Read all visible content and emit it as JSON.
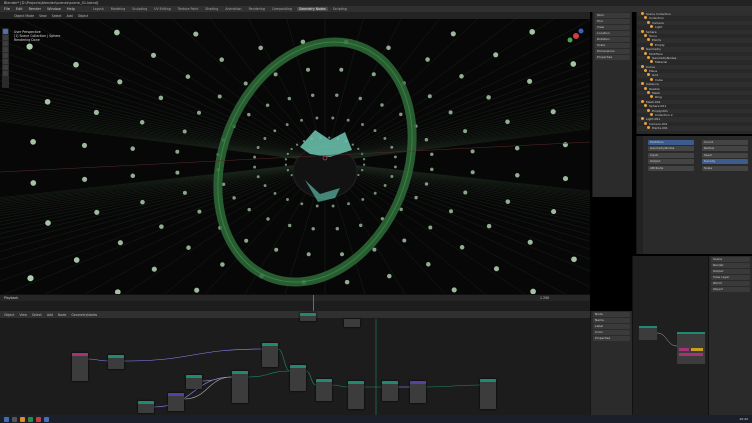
{
  "window": {
    "title": "Blender* [D:\\Projects\\blender\\scenes\\scene_01.blend]"
  },
  "menu": [
    "File",
    "Edit",
    "Render",
    "Window",
    "Help"
  ],
  "workspaces": [
    "Layout",
    "Modeling",
    "Sculpting",
    "UV Editing",
    "Texture Paint",
    "Shading",
    "Animation",
    "Rendering",
    "Compositing",
    "Geometry Nodes",
    "Scripting"
  ],
  "active_workspace": "Geometry Nodes",
  "viewport": {
    "header_items": [
      "Object Mode",
      "View",
      "Select",
      "Add",
      "Object"
    ],
    "overlay_lines": [
      "User Perspective",
      "(1) Scene Collection | Sphere",
      "Rendering Done"
    ]
  },
  "npanel_rows": [
    "Item",
    "Tool",
    "View",
    "Location",
    "Rotation",
    "Scale",
    "Dimensions",
    "Properties"
  ],
  "outliner": {
    "rows": [
      "Scene Collection",
      "Collection",
      "Camera",
      "Light",
      "Sphere",
      "Torus",
      "Points",
      "Empty",
      "Geometry",
      "Modifiers",
      "GeometryNodes",
      "Material",
      "Curve",
      "Plane",
      "Grid",
      "Cube",
      "Instance",
      "Realize",
      "Mesh",
      "Ring",
      "Mesh.001",
      "Sphere.001",
      "Empty.001",
      "Collection 2",
      "Light.001",
      "Camera.001",
      "Points.001"
    ]
  },
  "properties": {
    "fields": [
      "Modifiers",
      "GeometryNodes",
      "Input",
      "Output",
      "Attribute",
      "Count",
      "Radius",
      "Seed",
      "Density",
      "Scale"
    ]
  },
  "timeline": {
    "frame_label": "Playback",
    "start_end": "1 250"
  },
  "node_editor": {
    "header_items": [
      "Object",
      "View",
      "Select",
      "Add",
      "Node",
      "GeometryNodes"
    ],
    "node_labels": [
      "Group Input",
      "Mesh Line",
      "Instance on Points",
      "Transform",
      "Realize Instances",
      "Set Position",
      "Join Geometry",
      "Group Output",
      "Math",
      "Combine XYZ",
      "Distribute Points",
      "Ico Sphere",
      "Torus"
    ]
  },
  "side_panel": {
    "rows": [
      "Node",
      "Name",
      "Label",
      "Color",
      "Properties"
    ]
  },
  "right_props": {
    "rows": [
      "Scene",
      "Render",
      "Output",
      "View Layer",
      "World",
      "Object"
    ]
  },
  "taskbar": {
    "clock": "10:42"
  },
  "colors": {
    "accent": "#4772b3",
    "node_geo": "#1f8a70",
    "node_input": "#a8327a",
    "node_vector": "#5a3fa0",
    "points": "#c8f0c8",
    "ring": "#2e6b38"
  }
}
